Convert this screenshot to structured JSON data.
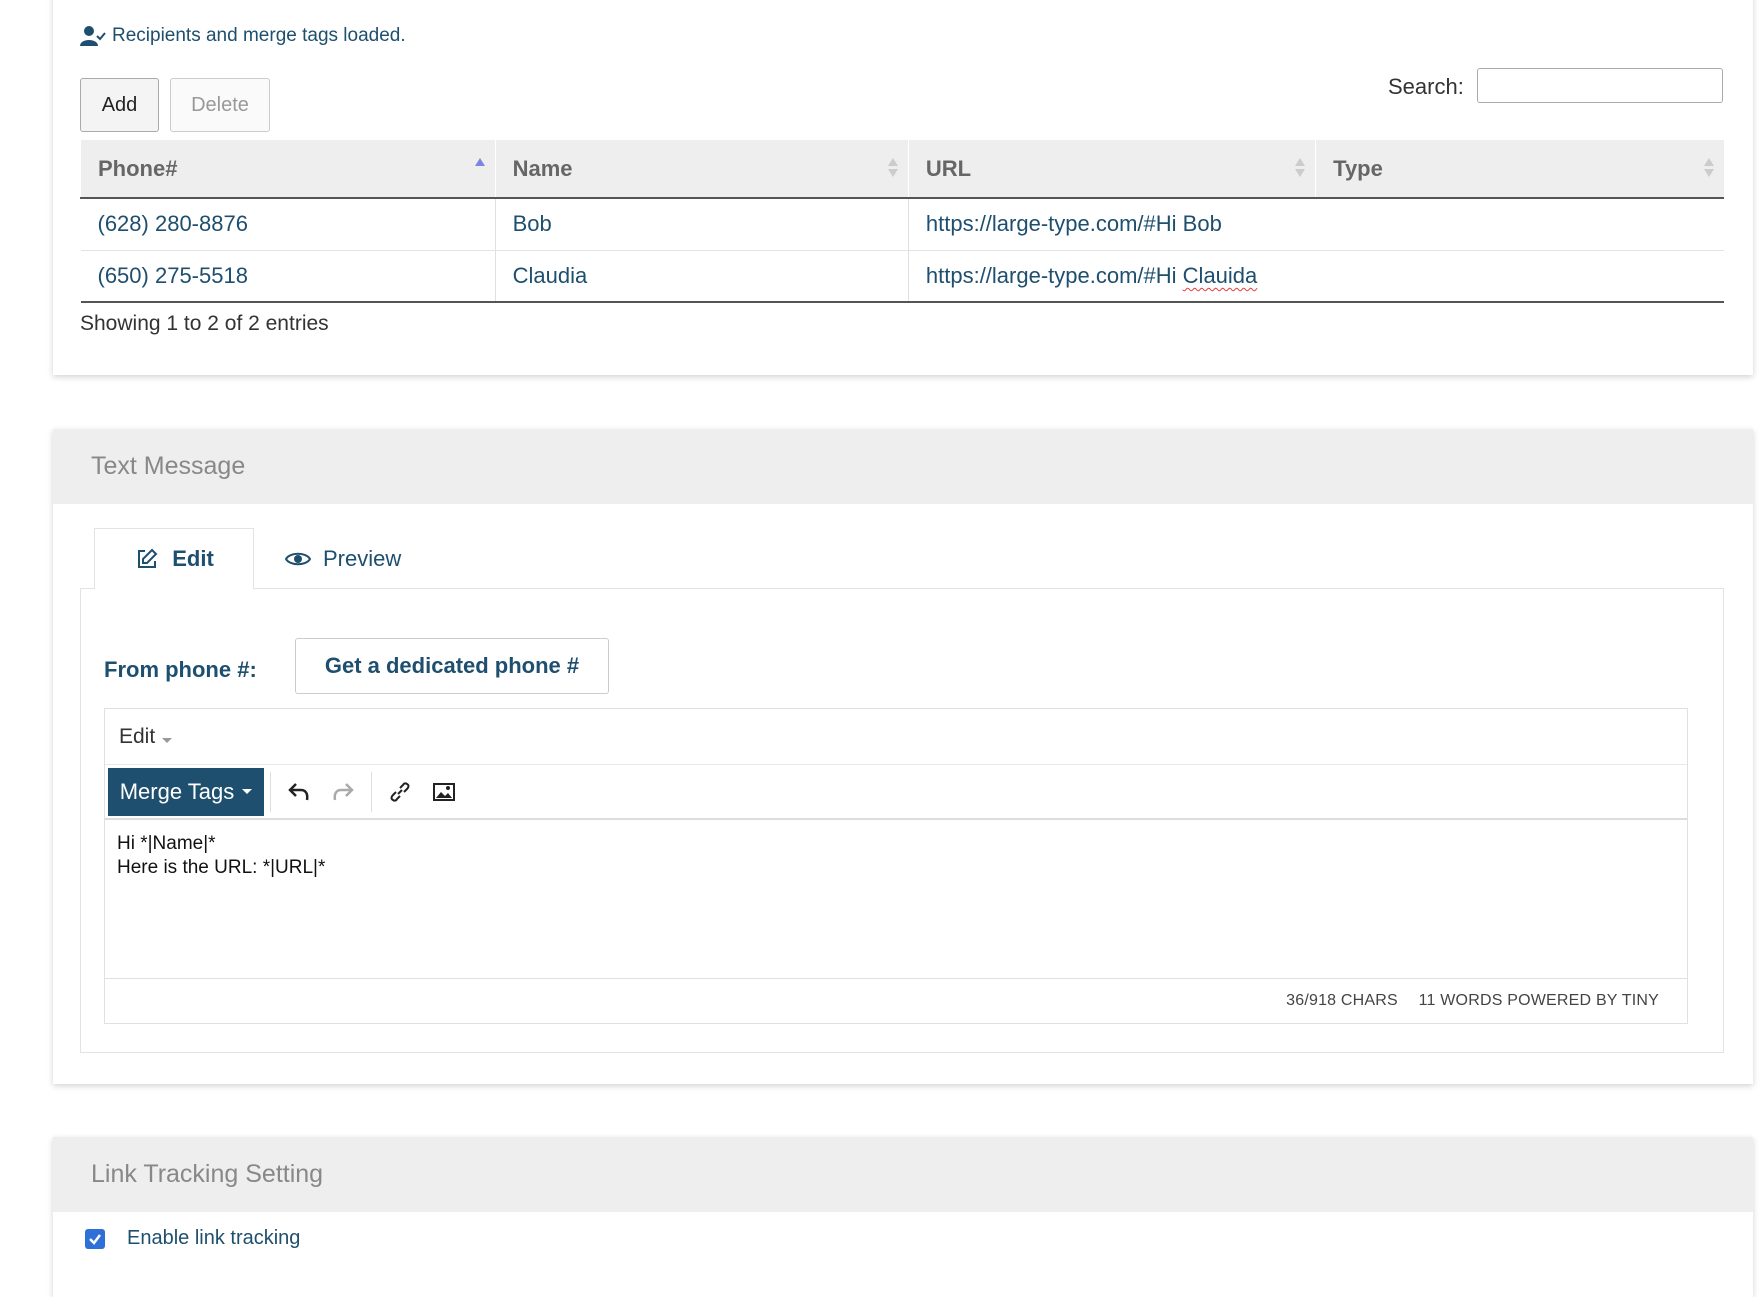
{
  "recipients": {
    "status_text": "Recipients and merge tags loaded.",
    "add_label": "Add",
    "delete_label": "Delete",
    "search_label": "Search:",
    "search_value": "",
    "columns": [
      "Phone#",
      "Name",
      "URL",
      "Type"
    ],
    "rows": [
      {
        "phone": "(628) 280-8876",
        "name": "Bob",
        "url_prefix": "https://large-type.com/#Hi ",
        "url_tail": "Bob"
      },
      {
        "phone": "(650) 275-5518",
        "name": "Claudia",
        "url_prefix": "https://large-type.com/#Hi ",
        "url_tail": "Clauida"
      }
    ],
    "info": "Showing 1 to 2 of 2 entries"
  },
  "text_message": {
    "heading": "Text Message",
    "tabs": {
      "edit": "Edit",
      "preview": "Preview"
    },
    "from_label": "From phone #:",
    "dedicated_label": "Get a dedicated phone #",
    "editor": {
      "menu_edit": "Edit",
      "merge_tags_label": "Merge Tags",
      "line1": "Hi *|Name|*",
      "line2": "Here is the URL: *|URL|*",
      "chars": "36/918 CHARS",
      "words": "11 WORDS POWERED BY TINY"
    }
  },
  "link_tracking": {
    "heading": "Link Tracking Setting",
    "enable_label": "Enable link tracking",
    "enabled": true
  },
  "colors": {
    "accent": "#1e4f6e",
    "panel_heading_bg": "#eeeeee",
    "checkbox": "#2e6fd8"
  }
}
